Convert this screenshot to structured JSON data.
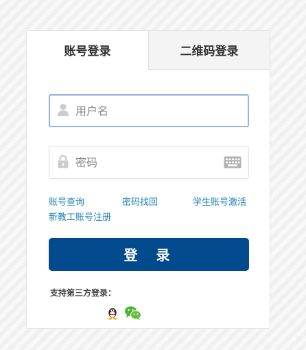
{
  "tabs": {
    "account_login": "账号登录",
    "qrcode_login": "二维码登录"
  },
  "form": {
    "username_placeholder": "用户名",
    "password_placeholder": "密码"
  },
  "links": {
    "account_query": "账号查询",
    "password_recovery": "密码找回",
    "student_activation": "学生账号激活",
    "staff_register": "新教工账号注册"
  },
  "login_button": "登 录",
  "third_party": {
    "label": "支持第三方登录：",
    "providers": [
      "qq-icon",
      "wechat-icon"
    ]
  },
  "colors": {
    "primary_button": "#004a8d",
    "link": "#1b7fb8",
    "focused_border": "#8fb2e0",
    "wechat_green": "#4cb62f"
  }
}
